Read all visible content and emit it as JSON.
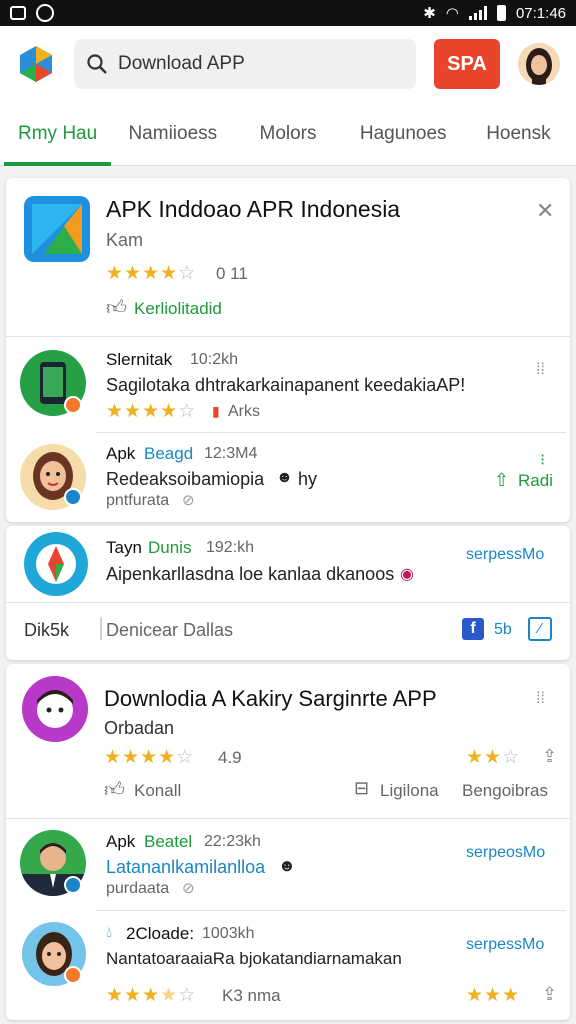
{
  "status_bar": {
    "time": "07:1:46"
  },
  "search": {
    "value": "Download APP",
    "button_label": "SPA"
  },
  "tabs": [
    "Rmy Hau",
    "Namiioess",
    "Molors",
    "Hagunoes",
    "Hoensk"
  ],
  "featured": {
    "title": "APK Inddoao APR Indonesia",
    "subtitle": "Kam",
    "rating_text": "0 11",
    "action_label": "Kerliolitadid"
  },
  "list1": [
    {
      "name": "Slernitak",
      "meta": "10:2kh",
      "desc": "Sagilotaka dhtrakarkainapanent keedakiaAP!",
      "rating_text": "Arks"
    },
    {
      "name": "Apk",
      "name2": "Beagd",
      "meta": "12:3M4",
      "desc": "Redeaksoibamiopia",
      "desc2": "hy",
      "sub": "pntfurata",
      "action_label": "Radi"
    }
  ],
  "list2": [
    {
      "name": "Tayn",
      "name2": "Dunis",
      "meta": "192:kh",
      "desc": "Aipenkarllasdna loe kanlaa dkanoos",
      "action_label": "serpessMo"
    }
  ],
  "filter_bar": {
    "label": "Dik5k",
    "sublabel": "Denicear Dallas",
    "count": "5b"
  },
  "feature2": {
    "title": "Downlodia A  Kakiry Sarginrte APP",
    "subtitle": "Orbadan",
    "rating_text": "4.9",
    "action1": "Konall",
    "action2": "Ligilona",
    "action3": "Bengoibras"
  },
  "list3": [
    {
      "name": "Apk",
      "name2": "Beatel",
      "meta": "22:23kh",
      "desc": "Latananlkamilanlloa",
      "sub": "purdaata",
      "action_label": "serpeosMo"
    },
    {
      "name": "2Cloade:",
      "meta": "1003kh",
      "desc": "NantatoaraaiaRa bjokatandiarnamakan",
      "rating_text": "K3 nma",
      "action_label": "serpessMo"
    }
  ],
  "colors": {
    "accent_green": "#1e9a3c",
    "accent_blue": "#1a86c8",
    "search_button": "#e8452c",
    "star": "#f2b01e"
  }
}
